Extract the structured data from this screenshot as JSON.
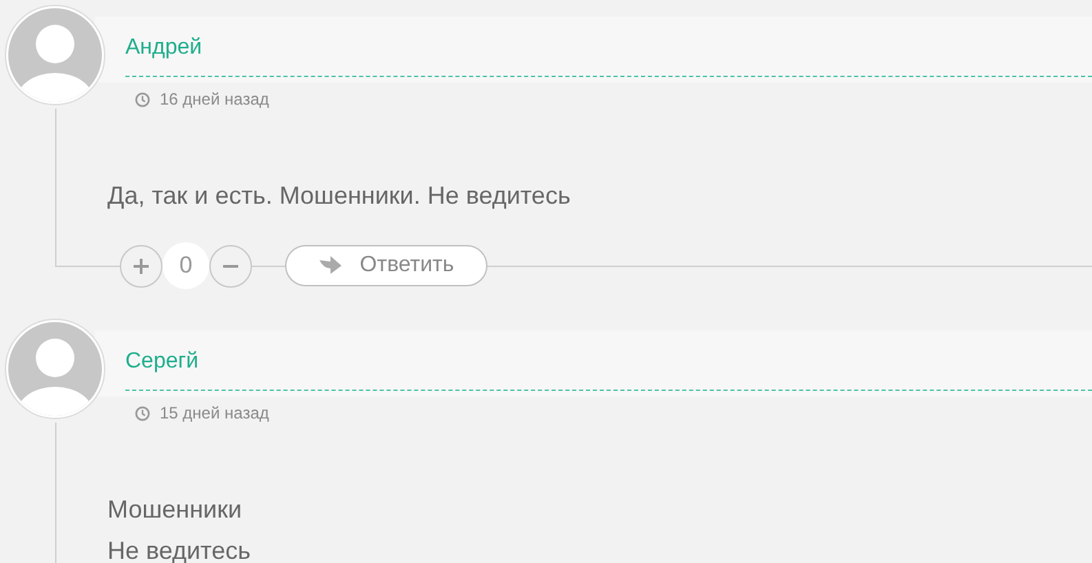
{
  "comments": [
    {
      "author": "Андрей",
      "time": "16 дней назад",
      "paragraphs": [
        "Да, так и есть. Мошенники. Не ведитесь"
      ],
      "actions": {
        "score": "0",
        "reply": "Ответить"
      }
    },
    {
      "author": "Серегй",
      "time": "15 дней назад",
      "paragraphs": [
        "Мошенники",
        "Не ведитесь"
      ]
    }
  ]
}
